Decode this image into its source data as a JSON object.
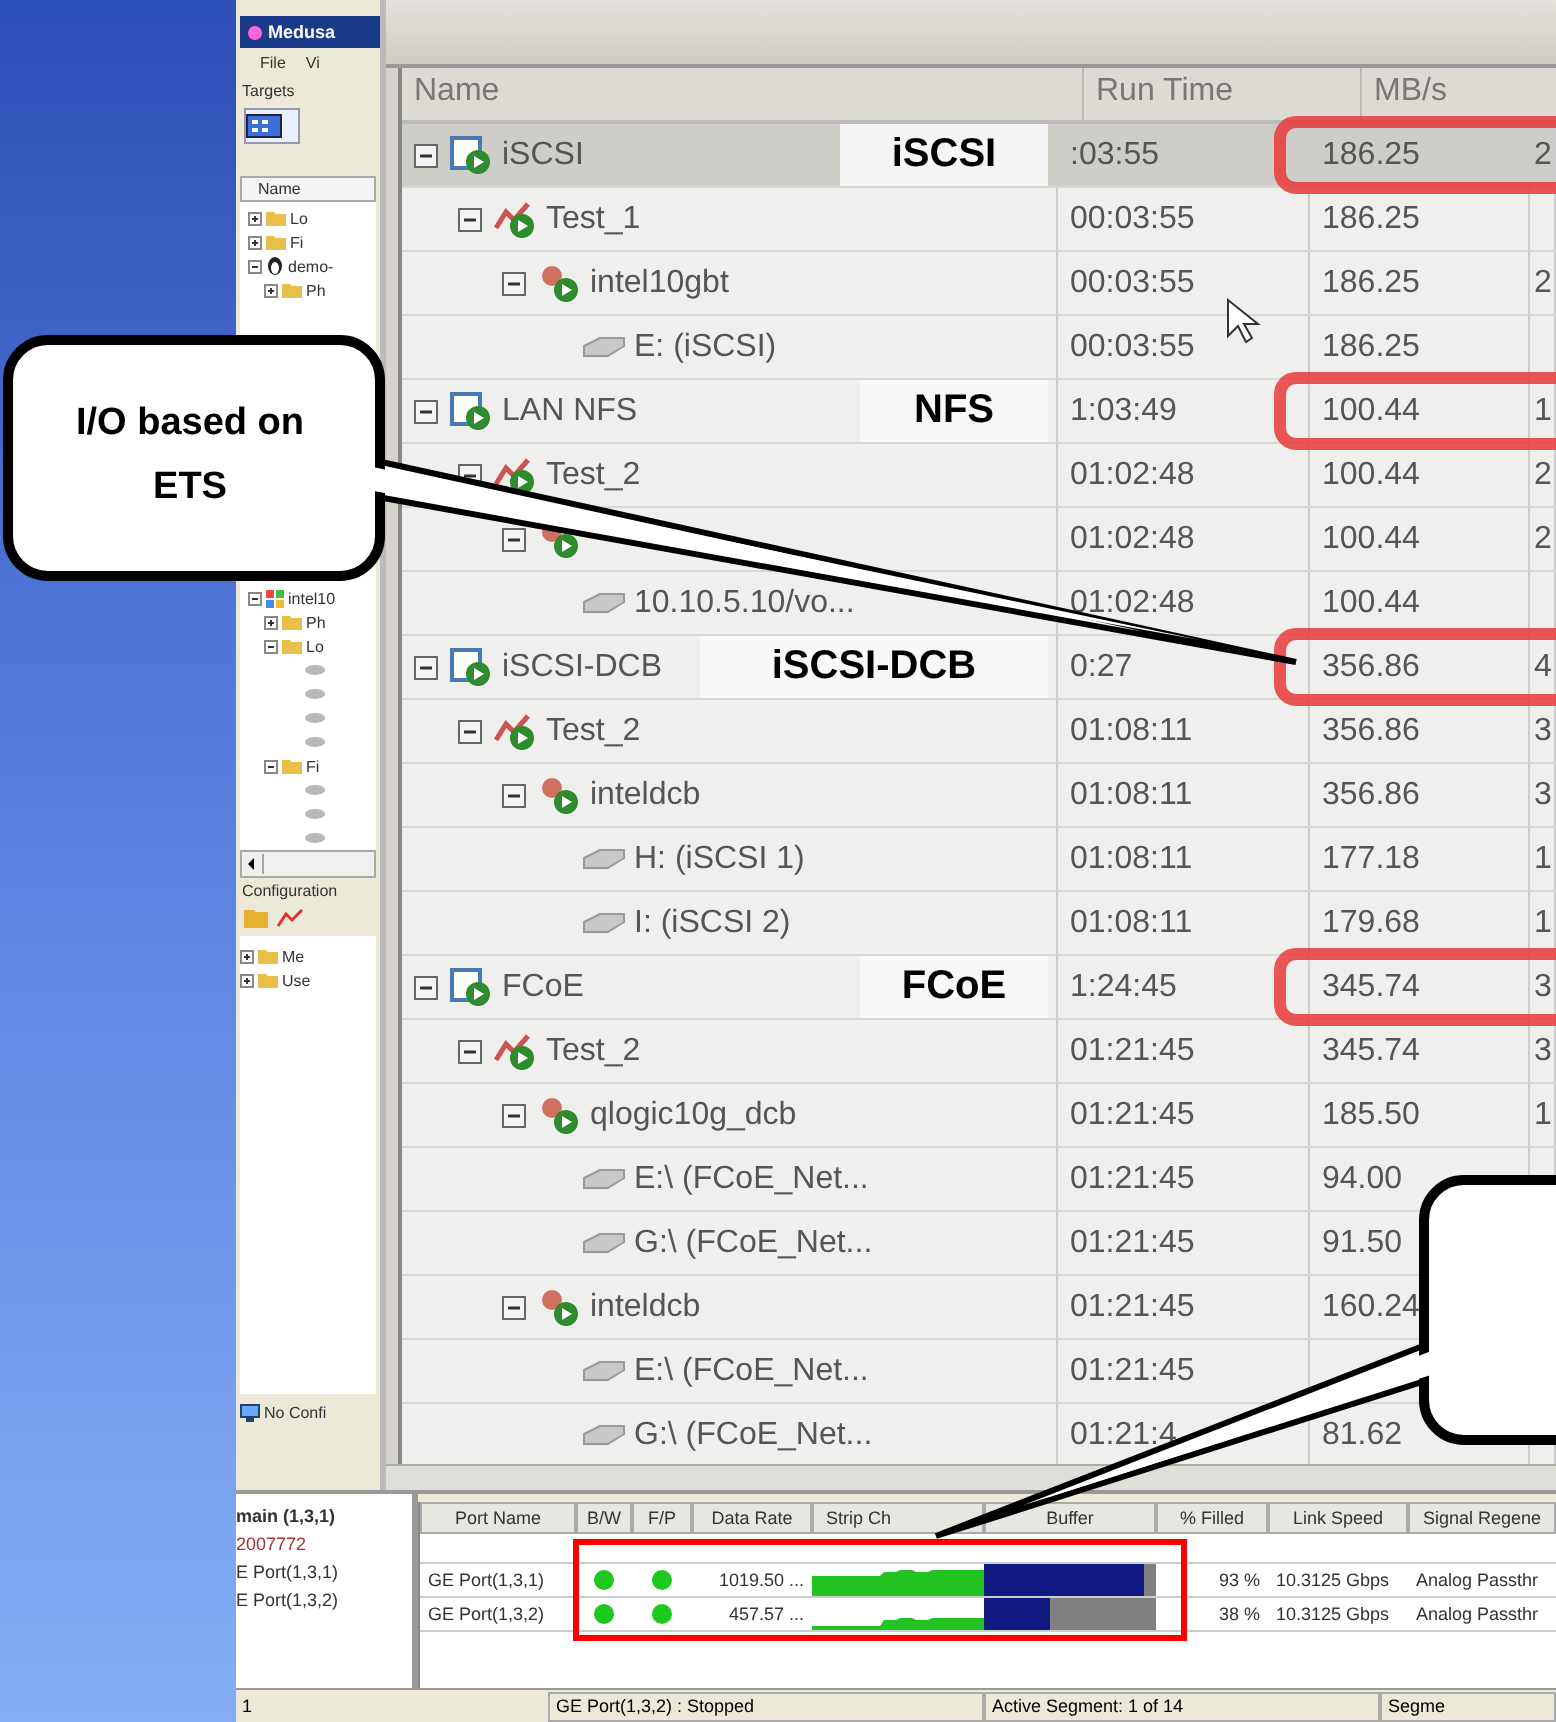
{
  "left_pane": {
    "app_title": "Medusa",
    "menu": [
      "File",
      "Vi"
    ],
    "section": "Targets",
    "column": "Name",
    "targets": [
      {
        "label": "Lo",
        "kind": "folder",
        "expanded": false
      },
      {
        "label": "Fi",
        "kind": "folder",
        "expanded": false
      },
      {
        "label": "demo-",
        "kind": "linux",
        "expanded": true,
        "children": [
          {
            "label": "Ph",
            "kind": "folder",
            "expanded": false
          }
        ]
      }
    ],
    "targets_lower": [
      {
        "label": "intel10",
        "kind": "windows",
        "expanded": true,
        "children": [
          {
            "label": "Ph",
            "kind": "folder",
            "expanded": false
          },
          {
            "label": "Lo",
            "kind": "folder",
            "expanded": true,
            "children": [
              {
                "kind": "disk"
              },
              {
                "kind": "disk"
              },
              {
                "kind": "disk"
              },
              {
                "kind": "disk"
              }
            ]
          },
          {
            "label": "Fi",
            "kind": "folder",
            "expanded": true,
            "children": [
              {
                "kind": "disk"
              },
              {
                "kind": "disk"
              },
              {
                "kind": "disk"
              }
            ]
          }
        ]
      }
    ],
    "config_title": "Configuration",
    "config_tree": [
      {
        "label": "Me",
        "expanded": false
      },
      {
        "label": "Use",
        "expanded": false
      }
    ],
    "status": "No Confi"
  },
  "tree": {
    "columns": [
      "Name",
      "Run Time",
      "MB/s"
    ],
    "nodes": [
      {
        "name": "iSCSI",
        "kind": "group",
        "expanded": true,
        "selected": true,
        "run_time": ":03:55",
        "mb_s": "186.25",
        "column_4": "2",
        "children": [
          {
            "name": "Test_1",
            "kind": "test",
            "expanded": true,
            "selected": false,
            "run_time": "00:03:55",
            "mb_s": "186.25",
            "children": [
              {
                "name": "intel10gbt",
                "kind": "host",
                "expanded": true,
                "selected": false,
                "run_time": "00:03:55",
                "mb_s": "186.25",
                "column_4": "2",
                "children": [
                  {
                    "name": "E: (iSCSI)",
                    "kind": "disk",
                    "selected": false,
                    "run_time": "00:03:55",
                    "mb_s": "186.25"
                  }
                ]
              }
            ]
          }
        ]
      },
      {
        "name": "LAN NFS",
        "kind": "group",
        "expanded": true,
        "selected": false,
        "run_time": "1:03:49",
        "mb_s": "100.44",
        "column_4": "1",
        "children": [
          {
            "name": "Test_2",
            "kind": "test",
            "expanded": true,
            "selected": false,
            "run_time": "01:02:48",
            "mb_s": "100.44",
            "column_4": "2",
            "children": [
              {
                "kind": "host",
                "expanded": true,
                "selected": false,
                "run_time": "01:02:48",
                "mb_s": "100.44",
                "column_4": "2",
                "children": [
                  {
                    "name": "10.10.5.10/vo...",
                    "kind": "disk",
                    "selected": false,
                    "run_time": "01:02:48",
                    "mb_s": "100.44"
                  }
                ]
              }
            ]
          }
        ]
      },
      {
        "name": "iSCSI-DCB",
        "kind": "group",
        "expanded": true,
        "selected": false,
        "run_time": "0:27",
        "mb_s": "356.86",
        "column_4": "4",
        "children": [
          {
            "name": "Test_2",
            "kind": "test",
            "expanded": true,
            "selected": false,
            "run_time": "01:08:11",
            "mb_s": "356.86",
            "column_4": "3",
            "children": [
              {
                "name": "inteldcb",
                "kind": "host",
                "expanded": true,
                "selected": false,
                "run_time": "01:08:11",
                "mb_s": "356.86",
                "column_4": "3",
                "children": [
                  {
                    "name": "H: (iSCSI 1)",
                    "kind": "disk",
                    "selected": false,
                    "run_time": "01:08:11",
                    "mb_s": "177.18",
                    "column_4": "1"
                  },
                  {
                    "name": "I: (iSCSI 2)",
                    "kind": "disk",
                    "selected": false,
                    "run_time": "01:08:11",
                    "mb_s": "179.68",
                    "column_4": "1"
                  }
                ]
              }
            ]
          }
        ]
      },
      {
        "name": "FCoE",
        "kind": "group",
        "expanded": true,
        "selected": false,
        "run_time": "1:24:45",
        "mb_s": "345.74",
        "column_4": "3",
        "children": [
          {
            "name": "Test_2",
            "kind": "test",
            "expanded": true,
            "selected": false,
            "run_time": "01:21:45",
            "mb_s": "345.74",
            "column_4": "3",
            "children": [
              {
                "name": "qlogic10g_dcb",
                "kind": "host",
                "expanded": true,
                "selected": false,
                "run_time": "01:21:45",
                "mb_s": "185.50",
                "column_4": "1",
                "children": [
                  {
                    "name": "E:\\ (FCoE_Net...",
                    "kind": "disk",
                    "selected": false,
                    "run_time": "01:21:45",
                    "mb_s": "94.00"
                  },
                  {
                    "name": "G:\\ (FCoE_Net...",
                    "kind": "disk",
                    "selected": false,
                    "run_time": "01:21:45",
                    "mb_s": "91.50"
                  }
                ]
              },
              {
                "name": "inteldcb",
                "kind": "host",
                "expanded": true,
                "selected": false,
                "run_time": "01:21:45",
                "mb_s": "160.24",
                "children": [
                  {
                    "name": "E:\\ (FCoE_Net...",
                    "kind": "disk",
                    "selected": false,
                    "run_time": "01:21:45"
                  },
                  {
                    "name": "G:\\ (FCoE_Net...",
                    "kind": "disk",
                    "selected": false,
                    "run_time": "01:21:4",
                    "mb_s": "81.62"
                  }
                ]
              }
            ]
          }
        ]
      }
    ]
  },
  "port_list": [
    "main (1,3,1)",
    "2007772",
    "E Port(1,3,1)",
    "E Port(1,3,2)"
  ],
  "port_table": {
    "columns": [
      "Port Name",
      "B/W",
      "F/P",
      "Data Rate",
      "Strip Ch",
      "Buffer",
      "% Filled",
      "Link Speed",
      "Signal Regene"
    ],
    "rows": [
      {
        "port": "GE Port(1,3,1)",
        "bw": {
          "color": "#1ec81e"
        },
        "fp": {
          "color": "#1ec81e"
        },
        "data_rate": "1019.50 ...",
        "buffer": {
          "level": 0.93
        },
        "filled": "93 %",
        "link_speed": "10.3125 Gbps",
        "signal": "Analog Passthr"
      },
      {
        "port": "GE Port(1,3,2)",
        "bw": {
          "color": "#1ec81e"
        },
        "fp": {
          "color": "#1ec81e"
        },
        "data_rate": "457.57 ...",
        "buffer": {
          "level": 0.38
        },
        "filled": "38 %",
        "link_speed": "10.3125 Gbps",
        "signal": "Analog Passthr"
      }
    ]
  },
  "status_bar": [
    "1",
    "GE Port(1,3,2) :  Stopped",
    "Active Segment: 1 of 14",
    "Segme"
  ],
  "annotations": {
    "callout": "I/O based on ETS",
    "labels": [
      "iSCSI",
      "NFS",
      "iSCSI-DCB",
      "FCoE"
    ]
  }
}
